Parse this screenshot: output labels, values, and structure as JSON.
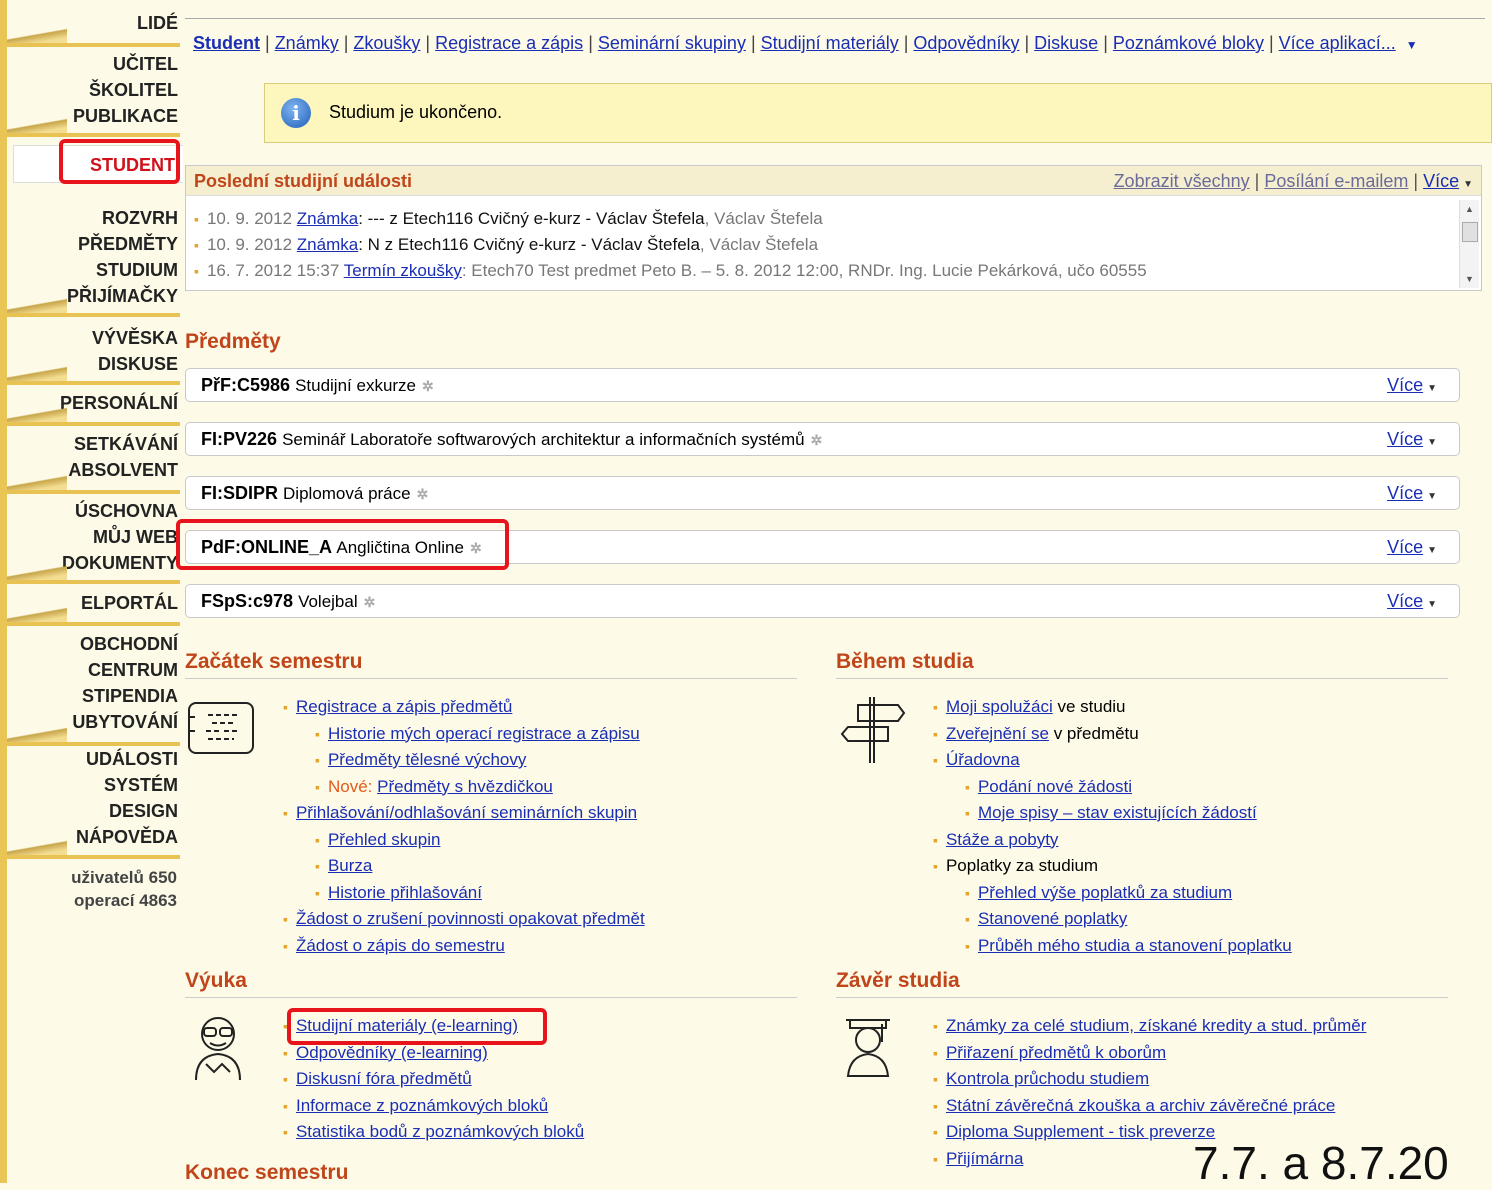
{
  "nav": {
    "groups": [
      [
        "LIDÉ"
      ],
      [
        "UČITEL",
        "ŠKOLITEL",
        "PUBLIKACE"
      ],
      [
        "ROZVRH",
        "PŘEDMĚTY",
        "STUDIUM",
        "PŘIJÍMAČKY"
      ],
      [
        "VÝVĚSKA",
        "DISKUSE"
      ],
      [
        "PERSONÁLNÍ"
      ],
      [
        "SETKÁVÁNÍ",
        "ABSOLVENT"
      ],
      [
        "ÚSCHOVNA",
        "MŮJ WEB",
        "DOKUMENTY"
      ],
      [
        "ELPORTÁL"
      ],
      [
        "OBCHODNÍ",
        "CENTRUM",
        "STIPENDIA",
        "UBYTOVÁNÍ"
      ],
      [
        "UDÁLOSTI",
        "SYSTÉM",
        "DESIGN",
        "NÁPOVĚDA"
      ]
    ],
    "active": "STUDENT",
    "stats": [
      "uživatelů 650",
      "operací 4863"
    ]
  },
  "toplinks": [
    "Student",
    "Známky",
    "Zkoušky",
    "Registrace a zápis",
    "Seminární skupiny",
    "Studijní materiály",
    "Odpovědníky",
    "Diskuse",
    "Poznámkové bloky",
    "Více aplikací..."
  ],
  "info": {
    "text": "Studium je ukončeno."
  },
  "events": {
    "title": "Poslední studijní události",
    "actions": [
      "Zobrazit všechny",
      "Posílání e-mailem",
      "Více"
    ],
    "items": [
      {
        "date": "10. 9. 2012",
        "type": "Známka",
        "text": ": --- z Etech116 Cvičný e-kurz - Václav Štefela",
        "who": ", Václav Štefela"
      },
      {
        "date": "10. 9. 2012",
        "type": "Známka",
        "text": ": N z Etech116 Cvičný e-kurz - Václav Štefela",
        "who": ", Václav Štefela"
      },
      {
        "date": "16. 7. 2012 15:37",
        "type": "Termín zkoušky",
        "text": ": Etech70 Test predmet Peto B. – 5. 8. 2012 12:00",
        "who": ", RNDr. Ing. Lucie Pekárková, učo 60555"
      }
    ]
  },
  "courses": {
    "title": "Předměty",
    "more_label": "Více",
    "items": [
      {
        "code": "PřF:C5986",
        "name": "Studijní exkurze"
      },
      {
        "code": "FI:PV226",
        "name": "Seminář Laboratoře softwarových architektur a informačních systémů"
      },
      {
        "code": "FI:SDIPR",
        "name": "Diplomová práce"
      },
      {
        "code": "PdF:ONLINE_A",
        "name": "Angličtina Online"
      },
      {
        "code": "FSpS:c978",
        "name": "Volejbal"
      }
    ]
  },
  "sections": {
    "start": {
      "title": "Začátek semestru",
      "items": [
        {
          "label": "Registrace a zápis předmětů",
          "level": 0
        },
        {
          "label": "Historie mých operací registrace a zápisu",
          "level": 1
        },
        {
          "label": "Předměty tělesné výchovy",
          "level": 1
        },
        {
          "prefix": "Nové: ",
          "label": "Předměty s hvězdičkou",
          "level": 1
        },
        {
          "label": "Přihlašování/odhlašování seminárních skupin",
          "level": 0
        },
        {
          "label": "Přehled skupin",
          "level": 1
        },
        {
          "label": "Burza",
          "level": 1
        },
        {
          "label": "Historie přihlašování",
          "level": 1
        },
        {
          "label": "Žádost o zrušení povinnosti opakovat předmět",
          "level": 0
        },
        {
          "label": "Žádost o zápis do semestru",
          "level": 0
        }
      ]
    },
    "during": {
      "title": "Během studia",
      "items": [
        {
          "label": "Moji spolužáci",
          "suffix": " ve studiu",
          "level": 0
        },
        {
          "label": "Zveřejnění se",
          "suffix": " v předmětu",
          "level": 0
        },
        {
          "label": "Úřadovna",
          "level": 0
        },
        {
          "label": "Podání nové žádosti",
          "level": 1
        },
        {
          "label": "Moje spisy – stav existujících žádostí",
          "level": 1
        },
        {
          "label": "Stáže a pobyty",
          "level": 0
        },
        {
          "plain": "Poplatky za studium",
          "level": 0
        },
        {
          "label": "Přehled výše poplatků za studium",
          "level": 1
        },
        {
          "label": "Stanovené poplatky",
          "level": 1
        },
        {
          "label": "Průběh mého studia a stanovení poplatku",
          "level": 1
        }
      ]
    },
    "teaching": {
      "title": "Výuka",
      "items": [
        {
          "label": "Studijní materiály (e-learning)",
          "level": 0
        },
        {
          "label": "Odpovědníky (e-learning)",
          "level": 0
        },
        {
          "label": "Diskusní fóra předmětů",
          "level": 0
        },
        {
          "label": "Informace z poznámkových bloků",
          "level": 0
        },
        {
          "label": "Statistika bodů z poznámkových bloků",
          "level": 0
        }
      ]
    },
    "end": {
      "title": "Závěr studia",
      "items": [
        {
          "label": "Známky za celé studium, získané kredity a stud. průměr",
          "level": 0
        },
        {
          "label": "Přiřazení předmětů k oborům",
          "level": 0
        },
        {
          "label": "Kontrola průchodu studiem",
          "level": 0
        },
        {
          "label": "Státní závěrečná zkouška a archiv závěrečné práce",
          "level": 0
        },
        {
          "label": "Diploma Supplement - tisk preverze",
          "level": 0
        },
        {
          "label": "Přijímárna",
          "level": 0
        }
      ]
    },
    "semester_end": {
      "title": "Konec semestru"
    }
  },
  "annotation": "7.7. a 8.7.20"
}
